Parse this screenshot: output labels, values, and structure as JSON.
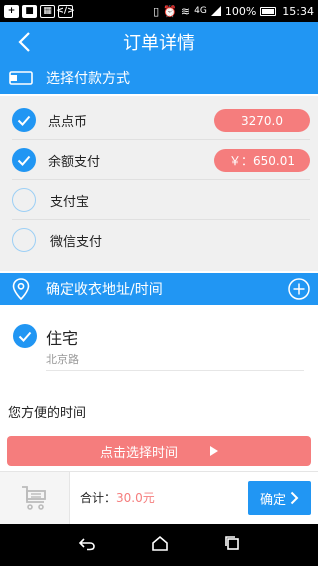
{
  "status_bar": {
    "battery": "100%",
    "time": "15:34",
    "network": "4G"
  },
  "header": {
    "title": "订单详情"
  },
  "payment": {
    "section_title": "选择付款方式",
    "options": [
      {
        "label": "点点币",
        "checked": true,
        "value": "3270.0"
      },
      {
        "label": "余额支付",
        "checked": true,
        "value": "￥：650.01"
      },
      {
        "label": "支付宝",
        "checked": false
      },
      {
        "label": "微信支付",
        "checked": false
      }
    ]
  },
  "address": {
    "section_title": "确定收衣地址/时间",
    "name": "住宅",
    "detail": "北京路",
    "selected": true
  },
  "time": {
    "label": "您方便的时间",
    "button_label": "点击选择时间"
  },
  "footer": {
    "total_label": "合计：",
    "total_amount": "30.0元",
    "confirm_label": "确定"
  },
  "colors": {
    "primary": "#2196f3",
    "accent_pink": "#f57d7d",
    "pay_bg": "#f0f0f0"
  }
}
